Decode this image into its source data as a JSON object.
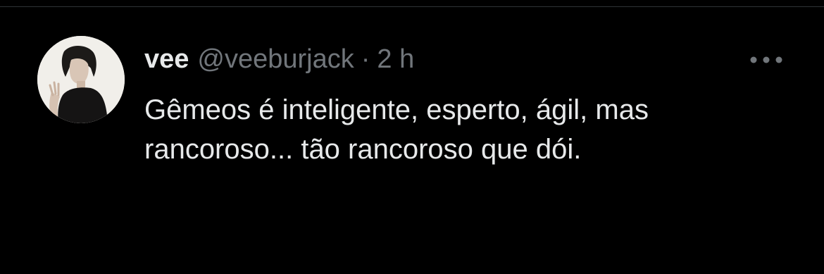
{
  "tweet": {
    "author": {
      "display_name": "vee",
      "handle": "@veeburjack",
      "avatar_icon": "profile-photo-woman"
    },
    "separator": "·",
    "timestamp": "2 h",
    "more_icon": "more-horizontal-icon",
    "text_lines": [
      "Gêmeos é inteligente, esperto, ágil, mas",
      "rancoroso... tão rancoroso que dói."
    ]
  },
  "colors": {
    "background": "#000000",
    "primary_text": "#e7e9ea",
    "secondary_text": "#71767b",
    "divider": "#2f3336"
  }
}
